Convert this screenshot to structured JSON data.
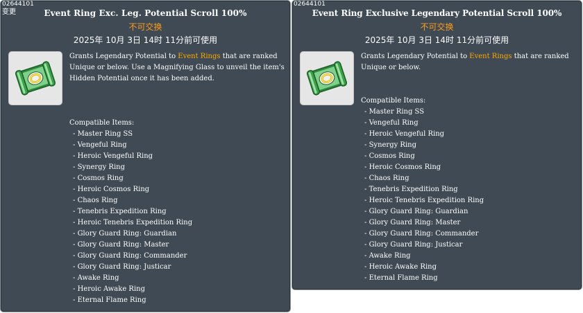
{
  "left": {
    "item_id": "02644101",
    "changed_label": "变更",
    "title": "Event Ring Exc. Leg. Potential Scroll 100%",
    "untradeable": "不可交换",
    "expiry": "2025年 10月 3日 14时 11分前可使用",
    "icon": "potential-scroll-icon",
    "desc_pre": "Grants Legendary Potential to ",
    "desc_highlight": "Event Rings",
    "desc_post": " that are ranked Unique or below. Use a Magnifying Glass to unveil the item's Hidden Potential once it has been added.",
    "compatible_header": "Compatible Items:",
    "compatible_items": [
      "Master Ring SS",
      "Vengeful Ring",
      "Heroic Vengeful Ring",
      "Synergy Ring",
      "Cosmos Ring",
      "Heroic Cosmos Ring",
      "Chaos Ring",
      "Tenebris Expedition Ring",
      "Heroic Tenebris Expedition Ring",
      "Glory Guard Ring: Guardian",
      "Glory Guard Ring: Master",
      "Glory Guard Ring: Commander",
      "Glory Guard Ring: Justicar",
      "Awake Ring",
      "Heroic Awake Ring",
      "Eternal Flame Ring"
    ]
  },
  "right": {
    "item_id": "02644101",
    "title": "Event Ring Exclusive Legendary Potential Scroll 100%",
    "untradeable": "不可交换",
    "expiry": "2025年 10月 3日 14时 11分前可使用",
    "icon": "potential-scroll-icon",
    "desc_pre": "Grants Legendary Potential to ",
    "desc_highlight": "Event Rings",
    "desc_post": " that are ranked Unique or below.",
    "compatible_header": "Compatible Items:",
    "compatible_items": [
      "Master Ring SS",
      "Vengeful Ring",
      "Heroic Vengeful Ring",
      "Synergy Ring",
      "Cosmos Ring",
      "Heroic Cosmos Ring",
      "Chaos Ring",
      "Tenebris Expedition Ring",
      "Heroic Tenebris Expedition Ring",
      "Glory Guard Ring: Guardian",
      "Glory Guard Ring: Master",
      "Glory Guard Ring: Commander",
      "Glory Guard Ring: Justicar",
      "Awake Ring",
      "Heroic Awake Ring",
      "Eternal Flame Ring"
    ]
  },
  "colors": {
    "panel_bg": "#3f4a54",
    "highlight": "#ffaa00",
    "untradeable": "#ff9c1a"
  }
}
